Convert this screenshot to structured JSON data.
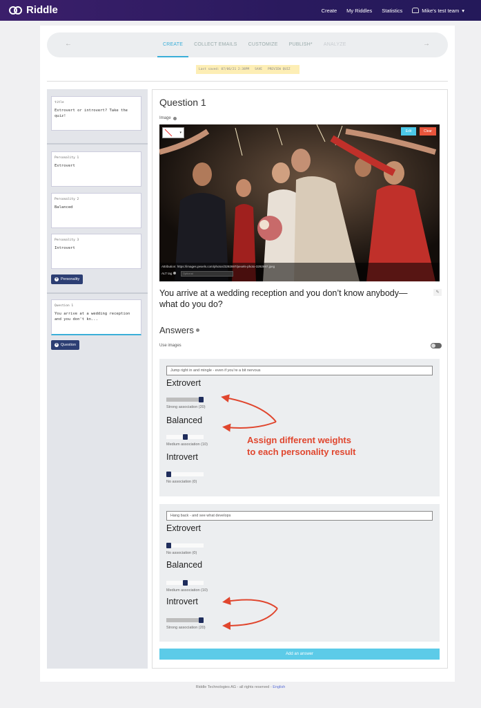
{
  "nav": {
    "brand": "Riddle",
    "links": [
      "Create",
      "My Riddles",
      "Statistics"
    ],
    "team": "Mike's test team",
    "team_caret": "▾"
  },
  "stepbar": {
    "prev_arrow": "←",
    "next_arrow": "→",
    "steps": [
      {
        "label": "CREATE",
        "state": "active"
      },
      {
        "label": "COLLECT EMAILS",
        "state": "normal"
      },
      {
        "label": "CUSTOMIZE",
        "state": "normal"
      },
      {
        "label": "PUBLISH*",
        "state": "normal"
      },
      {
        "label": "ANALYZE",
        "state": "disabled"
      }
    ]
  },
  "savebar": {
    "last_saved": "Last saved: 07/06/21 2:38PM",
    "save": "SAVE",
    "preview": "PREVIEW QUIZ"
  },
  "sidebar": {
    "title_card": {
      "label": "title",
      "text": "Extrovert or introvert? Take the quiz!"
    },
    "personalities": [
      {
        "label": "Personality 1",
        "text": "Extrovert"
      },
      {
        "label": "Personality 2",
        "text": "Balanced"
      },
      {
        "label": "Personality 3",
        "text": "Introvert"
      }
    ],
    "personality_button": "Personality",
    "question_card": {
      "label": "Question 1",
      "text": "You arrive at a wedding reception and you don't kn..."
    },
    "question_button": "Question"
  },
  "editor": {
    "question_title": "Question 1",
    "image_label": "Image",
    "edit_label": "Edit",
    "clear_label": "Clear",
    "attribution_label": "Attribution:",
    "attribution_url": "https://images.pexels.com/photos/3292697/pexels-photo-3292697.jpeg",
    "alt_tag_label": "ALT tag",
    "alt_placeholder": "Optional",
    "question_text": "You arrive at a wedding reception and you don’t know anybody— what do you do?",
    "answers_title": "Answers",
    "use_images_label": "Use images",
    "use_images_on": false,
    "answers": [
      {
        "text": "Jump right in and mingle - even if you’re a bit nervous",
        "mappings": [
          {
            "personality": "Extrovert",
            "label": "Strong association (20)",
            "level": 1.0
          },
          {
            "personality": "Balanced",
            "label": "Medium association (10)",
            "level": 0.5
          },
          {
            "personality": "Introvert",
            "label": "No association (0)",
            "level": 0.0
          }
        ]
      },
      {
        "text": "Hang back - and see what develops",
        "mappings": [
          {
            "personality": "Extrovert",
            "label": "No association (0)",
            "level": 0.0
          },
          {
            "personality": "Balanced",
            "label": "Medium association (10)",
            "level": 0.5
          },
          {
            "personality": "Introvert",
            "label": "Strong association (20)",
            "level": 1.0
          }
        ]
      }
    ],
    "add_answer_label": "Add an answer"
  },
  "annotation": {
    "line1": "Assign different weights",
    "line2": "to each personality result"
  },
  "footer": {
    "text": "Riddle Technologies AG - all rights reserved - ",
    "lang": "English"
  },
  "colors": {
    "accent": "#3aaed8",
    "button_dark": "#2c3e73",
    "annotation": "#e0462e",
    "clear": "#e8553c",
    "add_answer": "#5ccbe8"
  }
}
